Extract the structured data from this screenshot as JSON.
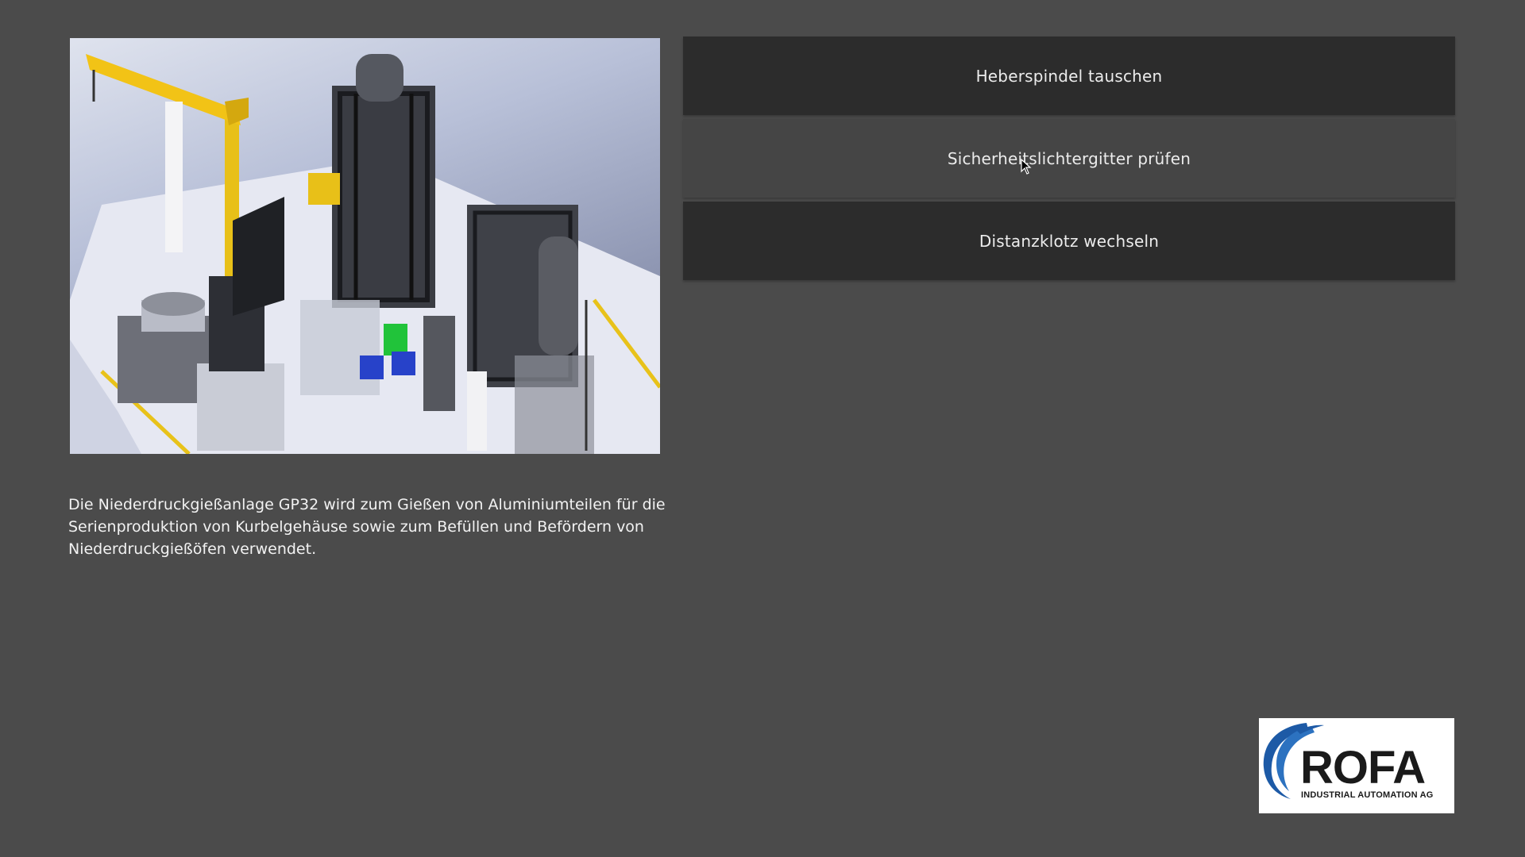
{
  "image": {
    "subject": "machine-rendering"
  },
  "description": {
    "text": "Die Niederdruckgießanlage GP32 wird zum Gießen von Aluminiumteilen für die Serienproduktion von Kurbelgehäuse sowie zum Befüllen und Befördern von Niederdruckgießöfen verwendet."
  },
  "actions": [
    {
      "label": "Heberspindel tauschen"
    },
    {
      "label": "Sicherheitslichtergitter prüfen"
    },
    {
      "label": "Distanzklotz wechseln"
    }
  ],
  "logo": {
    "wordmark": "ROFA",
    "tagline": "INDUSTRIAL AUTOMATION AG",
    "brand_blue": "#1d5aa6",
    "brand_dark": "#1a1a1a"
  },
  "colors": {
    "background": "#4b4b4b",
    "button": "#2c2c2c",
    "button_hover": "#454545",
    "text": "#f2f2f2",
    "accent_yellow": "#f2c316"
  }
}
